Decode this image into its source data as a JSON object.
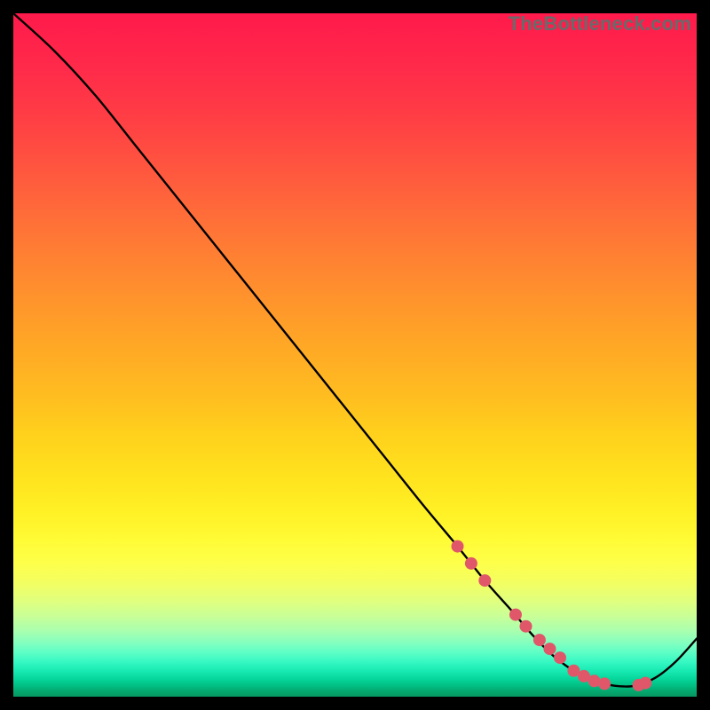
{
  "watermark": "TheBottleneck.com",
  "chart_data": {
    "type": "line",
    "title": "",
    "xlabel": "",
    "ylabel": "",
    "xlim": [
      0,
      100
    ],
    "ylim": [
      0,
      100
    ],
    "series": [
      {
        "name": "bottleneck-curve",
        "x": [
          0,
          6,
          12,
          18,
          24,
          30,
          36,
          42,
          48,
          54,
          60,
          65,
          69,
          73,
          76,
          79,
          82,
          85,
          88,
          91,
          94,
          97,
          100
        ],
        "values": [
          100,
          94.5,
          88,
          80.5,
          73,
          65.5,
          58,
          50.5,
          43,
          35.5,
          28,
          22,
          17,
          12.5,
          9,
          6,
          3.8,
          2.3,
          1.6,
          1.6,
          2.8,
          5.2,
          8.5
        ]
      }
    ],
    "markers": {
      "name": "highlight-dots",
      "color": "#e0576a",
      "radius_px": 7,
      "x": [
        65,
        67,
        69,
        73.5,
        75,
        77,
        78.5,
        80,
        82,
        83.5,
        85,
        86.5,
        91.5,
        92.5
      ],
      "values": [
        22,
        19.5,
        17,
        12,
        10.3,
        8.3,
        7,
        5.7,
        3.8,
        3,
        2.3,
        1.9,
        1.7,
        2.0
      ]
    }
  }
}
